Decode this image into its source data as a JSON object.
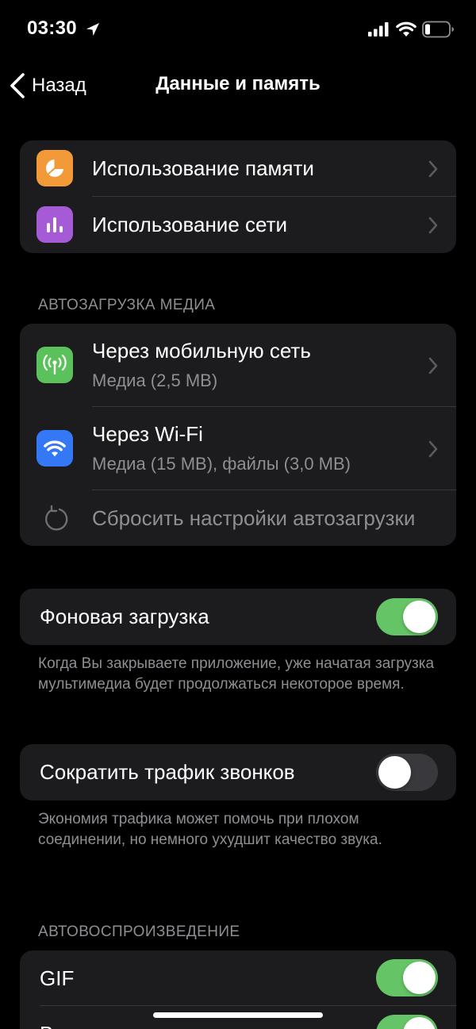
{
  "status_bar": {
    "time": "03:30",
    "icons": [
      "location-arrow-icon",
      "cellular-signal-icon",
      "wifi-icon",
      "battery-icon"
    ]
  },
  "nav": {
    "back_label": "Назад",
    "title": "Данные и память"
  },
  "storage_group": {
    "items": [
      {
        "label": "Использование памяти",
        "icon": "pie-chart-icon",
        "icon_color": "#f19a37"
      },
      {
        "label": "Использование сети",
        "icon": "bar-chart-icon",
        "icon_color": "#a55bd6"
      }
    ]
  },
  "auto_download": {
    "header": "АВТОЗАГРУЗКА МЕДИА",
    "items": [
      {
        "title": "Через мобильную сеть",
        "subtitle": "Медиа (2,5 MB)",
        "icon": "antenna-icon",
        "icon_color": "#5bc25b"
      },
      {
        "title": "Через Wi-Fi",
        "subtitle": "Медиа (15 MB), файлы (3,0 MB)",
        "icon": "wifi-icon",
        "icon_color": "#3478f6"
      }
    ],
    "reset_label": "Сбросить настройки автозагрузки"
  },
  "background_download": {
    "label": "Фоновая загрузка",
    "enabled": true,
    "footnote": "Когда Вы закрываете приложение, уже начатая загрузка мультимедиа будет продолжаться некоторое время."
  },
  "reduce_call_traffic": {
    "label": "Сократить трафик звонков",
    "enabled": false,
    "footnote": "Экономия трафика может помочь при плохом соединении, но немного ухудшит качество звука."
  },
  "autoplay": {
    "header": "АВТОВОСПРОИЗВЕДЕНИЕ",
    "items": [
      {
        "label": "GIF",
        "enabled": true
      },
      {
        "label": "В",
        "enabled": true
      }
    ]
  },
  "colors": {
    "background": "#000000",
    "group_background": "#1c1c1e",
    "toggle_on": "#65c466",
    "toggle_off": "#39393d",
    "secondary_text": "#8e8e93"
  }
}
